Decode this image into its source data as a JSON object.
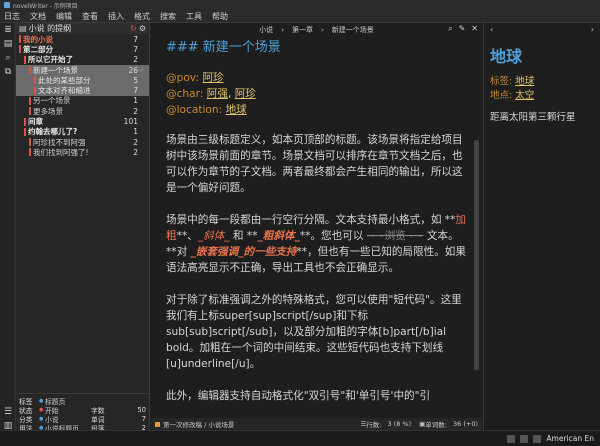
{
  "window": {
    "title": "novelWriter - 示例项目"
  },
  "menu": [
    "日志",
    "文档",
    "编辑",
    "查看",
    "插入",
    "格式",
    "搜索",
    "工具",
    "帮助"
  ],
  "tree": {
    "title": "小说 的提纲",
    "rows": [
      {
        "label": "我的小说",
        "count": "7",
        "indent": 0,
        "bar": "#d9534f",
        "color": "#e8724e",
        "bold": true,
        "selected": false,
        "check": ""
      },
      {
        "label": "第二部分",
        "count": "7",
        "indent": 0,
        "bar": "#d9534f",
        "color": "#e8e8e8",
        "bold": true,
        "selected": false,
        "check": ""
      },
      {
        "label": "所以它开始了",
        "count": "2",
        "indent": 1,
        "bar": "#d9534f",
        "color": "#e8e8e8",
        "bold": true,
        "selected": false,
        "check": ""
      },
      {
        "label": "新建一个场景",
        "count": "26",
        "indent": 2,
        "bar": "#d9534f",
        "color": "#e8e8e8",
        "bold": false,
        "selected": true,
        "check": "✓"
      },
      {
        "label": "此处的某些部分",
        "count": "5",
        "indent": 3,
        "bar": "#d9534f",
        "color": "#e8e8e8",
        "bold": false,
        "selected": true,
        "check": ""
      },
      {
        "label": "文本对齐和缩进",
        "count": "7",
        "indent": 3,
        "bar": "#d9534f",
        "color": "#e8e8e8",
        "bold": false,
        "selected": true,
        "check": ""
      },
      {
        "label": "另一个场景",
        "count": "1",
        "indent": 2,
        "bar": "#d9534f",
        "color": "#cfcfcf",
        "bold": false,
        "selected": false,
        "check": ""
      },
      {
        "label": "更多场景",
        "count": "2",
        "indent": 2,
        "bar": "#d9534f",
        "color": "#cfcfcf",
        "bold": false,
        "selected": false,
        "check": ""
      },
      {
        "label": "间章",
        "count": "101",
        "indent": 1,
        "bar": "#d9534f",
        "color": "#e8e8e8",
        "bold": true,
        "selected": false,
        "check": ""
      },
      {
        "label": "约翰去哪儿了?",
        "count": "1",
        "indent": 1,
        "bar": "#d9534f",
        "color": "#e8e8e8",
        "bold": true,
        "selected": false,
        "check": ""
      },
      {
        "label": "阿珍找不到阿强",
        "count": "2",
        "indent": 2,
        "bar": "#d9534f",
        "color": "#cfcfcf",
        "bold": false,
        "selected": false,
        "check": ""
      },
      {
        "label": "我们找到阿强了!",
        "count": "2",
        "indent": 2,
        "bar": "#d9534f",
        "color": "#cfcfcf",
        "bold": false,
        "selected": false,
        "check": ""
      }
    ]
  },
  "props": {
    "rows": [
      {
        "k": "标签",
        "dot": "#4fa0d8",
        "v": "标题页",
        "k2": "",
        "n": ""
      },
      {
        "k": "状态",
        "dot": "#d9534f",
        "v": "开始",
        "k2": "字数",
        "n": "50"
      },
      {
        "k": "分类",
        "dot": "#4fa0d8",
        "v": "小说",
        "k2": "单词",
        "n": "7"
      },
      {
        "k": "用法",
        "dot": "#4fa0d8",
        "v": "小说标题页",
        "k2": "段落",
        "n": "2"
      }
    ]
  },
  "editor_top": {
    "crumb1": "小说",
    "crumb2": "第一章",
    "crumb3": "新建一个场景"
  },
  "editor": {
    "heading": "### 新建一个场景",
    "pov_key": "@pov:",
    "pov_val": "阿珍",
    "char_key": "@char:",
    "char_val1": "阿强",
    "char_val2": "阿珍",
    "loc_key": "@location:",
    "loc_val": "地球",
    "p1": "场景由三级标题定义，如本页顶部的标题。该场景将指定给项目树中该场景前面的章节。场景文档可以排序在章节文档之后，也可以作为章节的子文档。两者最终都会产生相同的输出，所以这是一个偏好问题。",
    "p2a": "场景中的每一段都由一行空行分隔。文本支持最小格式，如 **",
    "p2b": "加粗",
    "p2c": "**、",
    "p2d": "_斜体_",
    "p2e": " 和 **",
    "p2f": "_粗斜体_",
    "p2g": "**。您也可以 ",
    "p2h": "~~浏览~~",
    "p2i": " 文本。**对 ",
    "p2j": "_嵌套强调_的一些支持",
    "p2k": "**，但也有一些已知的局限性。如果语法高亮显示不正确，导出工具也不会正确显示。",
    "p3": "对于除了标准强调之外的特殊格式，您可以使用\"短代码\"。这里我们有上标super[sup]script[/sup]和下标sub[sub]script[/sub]，以及部分加粗的字体[b]part[/b]ial bold。加粗在一个词的中间结束。这些短代码也支持下划线[u]underline[/u]。",
    "p4": "此外，编辑器支持自动格式化\"双引号\"和'单引号'中的\"引"
  },
  "status": {
    "crumb": "第一次修改稿 / 小说场景",
    "lines_label": "行数:",
    "lines_val": "3 (8 %)",
    "words_label": "单词数:",
    "words_val": "36 (+0)"
  },
  "viewer": {
    "title": "地球",
    "tag_key": "标签:",
    "tag_val": "地球",
    "loc_key": "地点:",
    "loc_val": "太空",
    "body": "距离太阳第三颗行星"
  },
  "taskbar": {
    "lang": "American En"
  }
}
